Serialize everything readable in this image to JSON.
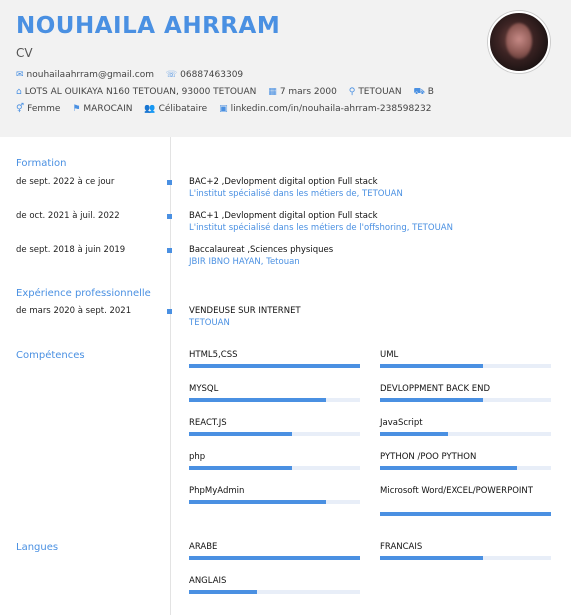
{
  "header": {
    "name": "NOUHAILA AHRRAM",
    "subtitle": "CV",
    "email": "nouhailaahrram@gmail.com",
    "phone": "06887463309",
    "address": "LOTS AL OUIKAYA N160 TETOUAN, 93000 TETOUAN",
    "birthdate": "7 mars 2000",
    "birthplace": "TETOUAN",
    "license": "B",
    "gender": "Femme",
    "nationality": "MAROCAIN",
    "marital_status": "Célibataire",
    "linkedin": "linkedin.com/in/nouhaila-ahrram-238598232"
  },
  "formation": {
    "title": "Formation",
    "entries": [
      {
        "date": "de sept. 2022 à ce jour",
        "title": "BAC+2 ,Devlopment digital option Full stack",
        "sub": "L'institut  spécialisé dans les métiers de, TETOUAN"
      },
      {
        "date": "de oct. 2021 à juil. 2022",
        "title": "BAC+1 ,Devlopment digital option Full stack",
        "sub": "L'institut  spécialisé dans les métiers de l'offshoring,  TETOUAN"
      },
      {
        "date": "de sept. 2018 à juin 2019",
        "title": "Baccalaureat ,Sciences physiques",
        "sub": "JBIR IBNO HAYAN,  Tetouan"
      }
    ]
  },
  "experience": {
    "title": "Expérience professionnelle",
    "entries": [
      {
        "date": "de mars 2020 à sept. 2021",
        "title": "VENDEUSE SUR INTERNET",
        "sub": "TETOUAN"
      }
    ]
  },
  "competences": {
    "title": "Compétences",
    "items": [
      {
        "label": "HTML5,CSS",
        "level": 1.0
      },
      {
        "label": "UML",
        "level": 0.6
      },
      {
        "label": "MYSQL",
        "level": 0.8
      },
      {
        "label": "DEVLOPPMENT BACK END",
        "level": 0.6
      },
      {
        "label": "REACT.JS",
        "level": 0.6
      },
      {
        "label": "JavaScript",
        "level": 0.4
      },
      {
        "label": "php",
        "level": 0.6
      },
      {
        "label": "PYTHON /POO PYTHON",
        "level": 0.8
      },
      {
        "label": "PhpMyAdmin",
        "level": 0.8
      },
      {
        "label": "Microsoft Word/EXCEL/POWERPOINT",
        "level": 1.0
      }
    ]
  },
  "langues": {
    "title": "Langues",
    "items": [
      {
        "label": "ARABE",
        "level": 1.0
      },
      {
        "label": "FRANCAIS",
        "level": 0.6
      },
      {
        "label": "ANGLAIS",
        "level": 0.4
      }
    ]
  },
  "colors": {
    "accent": "#4a90e2",
    "header_bg": "#f2f2f2"
  },
  "icons": [
    "envelope-icon",
    "phone-icon",
    "home-icon",
    "calendar-icon",
    "location-icon",
    "car-icon",
    "gender-icon",
    "flag-icon",
    "users-icon",
    "linkedin-icon"
  ]
}
